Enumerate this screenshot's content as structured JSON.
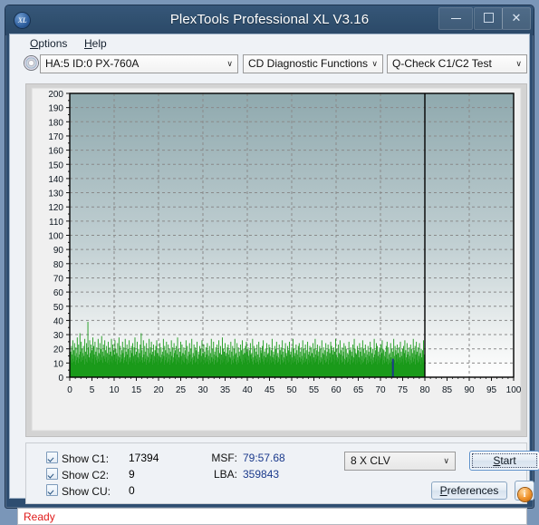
{
  "window": {
    "title": "PlexTools Professional XL V3.16",
    "logo_text": "XL",
    "minimize_label": "",
    "maximize_label": "",
    "close_label": "✕"
  },
  "menubar": {
    "items": [
      {
        "label": "Options",
        "mnemonic": "O"
      },
      {
        "label": "Help",
        "mnemonic": "H"
      }
    ]
  },
  "toolbar": {
    "drive_combo": {
      "value": "HA:5 ID:0  PX-760A",
      "icon": "disc-icon",
      "arrow": "∨"
    },
    "function_combo": {
      "value": "CD Diagnostic Functions",
      "arrow": "∨"
    },
    "test_combo": {
      "value": "Q-Check C1/C2 Test",
      "arrow": "∨"
    }
  },
  "controls": {
    "show_c1": {
      "label": "Show C1:",
      "value": "17394",
      "color": "#1a8a1a",
      "checked": true
    },
    "show_c2": {
      "label": "Show C2:",
      "value": "9",
      "color": "#1b3a8c",
      "checked": true
    },
    "show_cu": {
      "label": "Show CU:",
      "value": "0",
      "color": "#d01515",
      "checked": true
    },
    "msf": {
      "label": "MSF:",
      "value": "79:57.68"
    },
    "lba": {
      "label": "LBA:",
      "value": "359843"
    },
    "speed_combo": {
      "value": "8 X CLV",
      "arrow": "∨"
    },
    "start_button": {
      "label": "Start",
      "mnemonic": "S"
    },
    "preferences_button": {
      "label": "Preferences",
      "mnemonic": "P"
    },
    "info_button": {
      "label": "i"
    }
  },
  "statusbar": {
    "text": "Ready",
    "color": "#e01b1b"
  },
  "chart_data": {
    "type": "area",
    "title": "",
    "xlabel": "",
    "ylabel": "",
    "xlim": [
      0,
      100
    ],
    "ylim": [
      0,
      200
    ],
    "xticks": [
      0,
      5,
      10,
      15,
      20,
      25,
      30,
      35,
      40,
      45,
      50,
      55,
      60,
      65,
      70,
      75,
      80,
      85,
      90,
      95,
      100
    ],
    "yticks": [
      0,
      10,
      20,
      30,
      40,
      50,
      60,
      70,
      80,
      90,
      100,
      110,
      120,
      130,
      140,
      150,
      160,
      170,
      180,
      190,
      200
    ],
    "grid": true,
    "legend": "none",
    "data_end_x": 80,
    "cursor_line_x": 80,
    "plot_bg_top": "#8fa9ae",
    "plot_bg_bottom": "#ffffff",
    "series": [
      {
        "name": "C1",
        "color": "#1a9a1a",
        "total": 17394,
        "x_step": 0.25,
        "values": [
          14,
          18,
          12,
          22,
          16,
          10,
          26,
          13,
          19,
          11,
          24,
          15,
          9,
          21,
          17,
          12,
          28,
          14,
          10,
          23,
          16,
          13,
          31,
          18,
          11,
          25,
          14,
          20,
          12,
          17,
          22,
          15,
          9,
          27,
          13,
          18,
          11,
          24,
          16,
          10,
          39,
          21,
          14,
          12,
          26,
          17,
          11,
          23,
          15,
          19,
          10,
          28,
          13,
          22,
          16,
          9,
          25,
          14,
          18,
          12,
          21,
          15,
          10,
          27,
          13,
          17,
          11,
          24,
          16,
          20,
          12,
          29,
          14,
          18,
          10,
          23,
          15,
          13,
          26,
          11,
          19,
          14,
          22,
          10,
          17,
          12,
          25,
          16,
          9,
          21,
          13,
          18,
          11,
          27,
          15,
          10,
          23,
          14,
          19,
          12,
          16,
          26,
          11,
          20,
          13,
          17,
          9,
          24,
          15,
          12,
          28,
          14,
          10,
          22,
          16,
          11,
          19,
          13,
          25,
          17,
          10,
          21,
          14,
          12,
          27,
          15,
          18,
          11,
          23,
          16,
          9,
          20,
          13,
          26,
          14,
          11,
          19,
          12,
          22,
          17,
          10,
          24,
          15,
          13,
          21,
          11,
          28,
          16,
          9,
          18,
          12,
          25,
          14,
          10,
          20,
          13,
          17,
          11,
          23,
          15,
          31,
          12,
          19,
          14,
          10,
          26,
          16,
          11,
          22,
          13,
          18,
          9,
          24,
          15,
          12,
          20,
          14,
          10,
          27,
          17,
          11,
          21,
          13,
          25,
          16,
          9,
          18,
          12,
          23,
          15,
          10,
          19,
          14,
          22,
          11,
          26,
          13,
          17,
          9,
          20,
          15,
          12,
          24,
          14,
          10,
          21,
          16,
          11,
          18,
          13,
          27,
          15,
          9,
          22,
          12,
          19,
          14,
          25,
          10,
          17,
          11,
          23,
          16,
          13,
          20,
          9,
          18,
          12,
          26,
          15,
          10,
          21,
          14,
          11,
          24,
          17,
          13,
          19,
          9,
          22,
          12,
          16,
          28,
          11,
          20,
          14,
          10,
          18,
          13,
          25,
          15,
          9,
          23,
          12,
          17,
          11,
          21,
          16,
          10,
          19,
          14,
          26,
          13,
          9,
          22,
          15,
          12,
          18,
          10,
          24,
          16,
          11,
          20,
          13,
          27,
          14,
          9,
          17,
          12,
          23,
          15,
          10,
          21,
          11,
          19,
          14,
          25,
          13,
          9,
          18,
          16,
          12,
          22,
          10,
          20,
          15,
          11,
          26,
          13,
          17,
          9,
          23,
          12,
          18,
          14,
          10,
          21,
          16,
          11,
          24,
          13,
          19,
          9,
          15,
          22,
          12,
          17,
          10,
          27,
          14,
          11,
          20,
          13,
          25,
          16,
          9,
          18,
          12,
          21,
          15,
          10,
          23,
          14,
          11,
          19,
          26,
          13,
          17,
          9,
          22,
          12,
          16,
          10,
          28,
          14,
          20,
          11,
          18,
          13,
          24,
          15,
          9,
          17,
          12,
          21,
          10,
          23,
          16,
          11,
          19,
          14,
          13,
          25,
          9,
          18,
          12,
          22,
          15,
          10,
          20,
          13,
          27,
          16,
          11,
          17,
          9,
          24,
          14,
          12,
          21,
          10,
          18,
          15,
          13,
          23,
          11,
          19,
          9,
          26,
          16,
          12,
          20,
          10,
          17,
          14,
          22,
          13,
          25,
          11,
          18,
          9,
          21,
          15,
          12,
          19,
          10,
          24,
          16,
          13,
          17,
          11,
          27,
          14,
          9,
          22,
          12,
          20,
          15,
          10,
          18,
          13,
          23,
          11,
          16,
          9,
          25,
          14,
          12,
          21,
          10,
          19,
          17,
          13,
          22,
          11,
          26,
          15,
          9,
          18,
          12,
          20,
          14,
          10,
          24,
          16,
          11,
          17,
          13,
          23,
          9,
          21,
          15,
          12,
          19,
          10,
          27,
          14,
          11,
          18,
          16,
          13,
          22,
          9,
          20,
          12,
          25,
          15,
          10,
          17,
          14,
          11,
          23,
          13,
          19,
          9,
          21,
          16,
          12,
          26,
          10,
          18,
          14,
          11,
          20,
          13,
          24,
          9,
          17,
          15,
          12,
          22,
          10,
          19,
          11,
          25,
          16,
          13,
          18,
          9,
          21,
          14,
          12,
          27,
          10,
          20,
          15,
          11,
          17,
          13,
          23,
          9,
          19,
          16,
          12,
          22,
          10,
          24,
          14,
          11,
          18,
          13,
          21,
          9,
          15,
          26,
          12,
          20,
          10,
          17,
          14,
          23,
          11,
          19,
          13,
          9,
          25,
          16,
          12,
          18,
          10,
          22,
          15,
          11,
          21,
          13,
          17,
          9,
          24,
          14,
          12,
          20,
          10,
          27,
          16,
          11,
          19,
          13,
          23,
          15,
          9,
          18,
          12,
          22,
          10,
          20,
          14,
          11,
          26,
          13,
          17,
          9,
          21,
          16,
          12,
          19,
          10,
          24,
          15,
          11,
          18,
          13,
          23,
          9,
          20,
          12,
          17,
          14,
          25,
          10,
          22,
          11,
          19,
          16,
          13,
          21,
          9,
          18,
          12,
          27,
          15,
          10,
          20,
          14,
          11,
          23,
          13,
          17,
          9,
          26,
          16,
          12,
          19,
          10,
          21,
          15,
          11,
          18,
          24,
          13,
          9,
          22,
          12,
          20,
          14,
          10,
          17,
          16,
          11,
          25,
          13,
          19,
          9,
          21,
          12,
          18,
          15,
          10,
          23,
          14,
          11,
          27,
          13,
          20,
          9,
          17,
          16,
          12,
          22,
          10,
          19,
          14,
          11,
          24,
          13,
          18,
          9,
          21,
          15,
          12,
          26,
          10,
          20,
          11,
          17,
          13,
          23,
          14,
          9,
          19,
          16,
          12,
          22,
          10,
          18,
          15,
          11,
          25,
          13,
          21,
          9,
          17,
          12,
          20,
          14,
          10,
          27,
          16,
          11,
          19,
          13,
          24,
          9,
          22,
          15,
          12,
          18,
          10,
          21,
          14,
          11,
          23,
          13,
          17,
          26,
          9,
          20,
          12,
          19,
          15,
          10,
          18,
          14,
          22,
          11,
          25,
          13,
          9,
          21,
          16,
          12,
          17,
          10,
          24,
          14,
          11,
          20,
          13,
          18,
          9,
          27,
          15,
          12,
          22,
          10,
          19,
          16,
          11,
          23,
          13,
          17,
          9,
          21,
          14,
          12,
          25,
          10,
          18,
          15,
          11,
          20,
          13,
          22,
          9,
          17,
          26,
          12,
          19,
          14,
          10,
          24,
          16,
          11,
          18,
          13,
          21,
          9,
          15,
          23,
          12,
          20,
          10,
          17,
          14,
          27,
          11,
          19,
          13,
          22,
          9,
          16,
          25,
          12,
          18,
          10,
          21,
          15,
          11,
          24,
          13,
          17,
          9,
          20,
          14,
          12,
          19,
          10,
          26,
          16,
          11,
          22
        ]
      },
      {
        "name": "C2",
        "color": "#1b3a8c",
        "total": 9,
        "spikes": [
          {
            "x": 72.8,
            "y": 13
          }
        ]
      },
      {
        "name": "CU",
        "color": "#d01515",
        "total": 0,
        "spikes": []
      }
    ]
  }
}
